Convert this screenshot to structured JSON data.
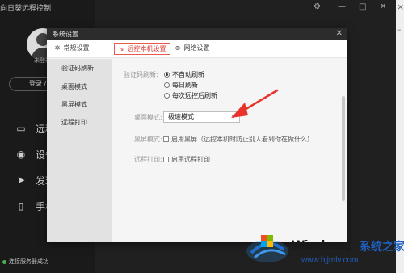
{
  "app": {
    "title": "向日葵远程控制",
    "title_controls": {
      "settings_icon": "gear-icon",
      "minimize": "—",
      "maximize": "□",
      "close": "✕"
    },
    "user_name": "未登录",
    "login_label": "登录 / 注册",
    "nav": [
      {
        "icon": "computer-icon",
        "label": "远程协助"
      },
      {
        "icon": "device-icon",
        "label": "设备列表"
      },
      {
        "icon": "send-icon",
        "label": "发现"
      },
      {
        "icon": "phone-icon",
        "label": "手机"
      }
    ],
    "status_text": "连接服务器成功"
  },
  "dialog": {
    "title": "系统设置",
    "close": "✕",
    "tabs": [
      {
        "icon": "gear-icon",
        "label": "常规设置",
        "active": false
      },
      {
        "icon": "remote-icon",
        "label": "远控本机设置",
        "active": true
      },
      {
        "icon": "network-icon",
        "label": "网络设置",
        "active": false
      }
    ],
    "sidebar": [
      "验证码刷新",
      "桌面模式",
      "黑屏模式",
      "远程打印"
    ],
    "verify_label": "验证码刷新:",
    "verify_options": [
      {
        "label": "不自动刷新",
        "selected": true
      },
      {
        "label": "每日刷新",
        "selected": false
      },
      {
        "label": "每次远控后刷新",
        "selected": false
      }
    ],
    "desktop_label": "桌面模式:",
    "desktop_value": "极速模式",
    "dropdown_arrow": "▼",
    "blackscreen_label": "黑屏模式:",
    "blackscreen_option": "启用黑屏（远控本机时防止别人看到你在做什么）",
    "blackscreen_checked": false,
    "print_label": "远程打印:",
    "print_option": "启用远程打印",
    "print_checked": false
  },
  "annotation_color": "#e8332c",
  "watermark": {
    "brand": "Windows",
    "cn": "系统之家",
    "url": "www.bjjmlv.com"
  }
}
